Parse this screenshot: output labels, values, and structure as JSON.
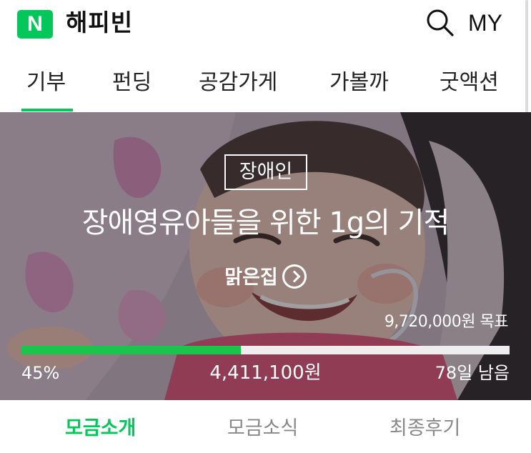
{
  "header": {
    "logo_letter": "N",
    "brand": "해피빈",
    "my_label": "MY",
    "search_icon": "search-icon",
    "accent_color": "#03c75a"
  },
  "tabs": [
    {
      "label": "기부",
      "active": true
    },
    {
      "label": "펀딩",
      "active": false
    },
    {
      "label": "공감가게",
      "active": false
    },
    {
      "label": "가볼까",
      "active": false
    },
    {
      "label": "굿액션",
      "active": false
    }
  ],
  "campaign": {
    "category": "장애인",
    "title": "장애영유아들을 위한 1g의 기적",
    "organization": "맑은집",
    "goal": "9,720,000원 목표",
    "progress_percent": 45,
    "percent_label": "45%",
    "raised": "4,411,100원",
    "remaining": "78일 남음",
    "progress_color": "#1bc54b"
  },
  "subtabs": [
    {
      "label": "모금소개",
      "active": true
    },
    {
      "label": "모금소식",
      "active": false
    },
    {
      "label": "최종후기",
      "active": false
    }
  ]
}
